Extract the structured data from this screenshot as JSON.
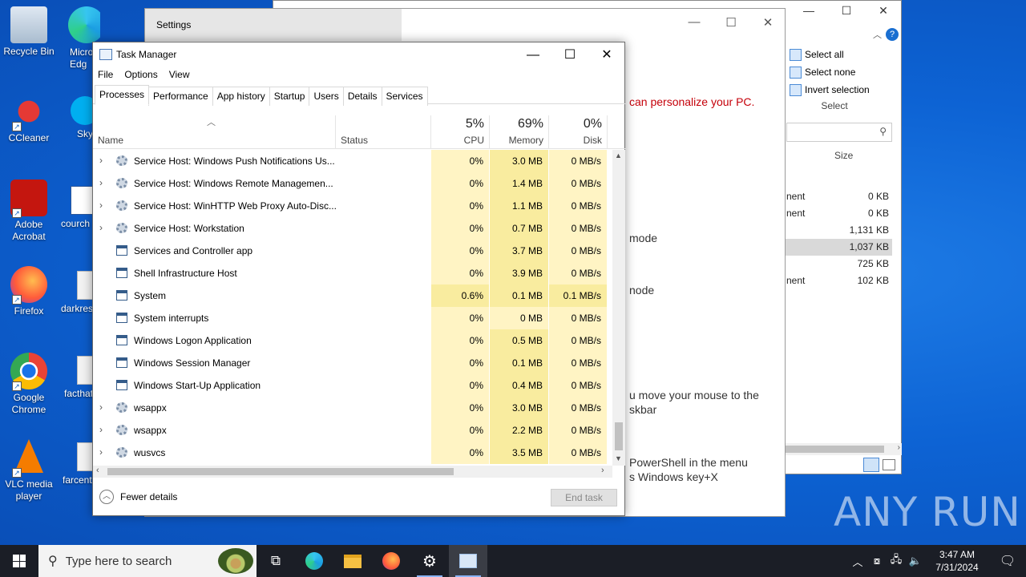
{
  "desktop": {
    "icons": [
      {
        "label": "Recycle Bin",
        "icon": "recycle-bin-icon"
      },
      {
        "label": "CCleaner",
        "icon": "ccleaner-icon"
      },
      {
        "label": "Adobe Acrobat",
        "icon": "acrobat-icon"
      },
      {
        "label": "Firefox",
        "icon": "firefox-icon"
      },
      {
        "label": "Google Chrome",
        "icon": "chrome-icon"
      },
      {
        "label": "VLC media player",
        "icon": "vlc-icon"
      }
    ],
    "partial_icons": [
      {
        "label": "Micro Edg",
        "icon": "edge-icon"
      },
      {
        "label": "Sky",
        "icon": "skype-icon"
      },
      {
        "label": "courch",
        "icon": "word-icon"
      },
      {
        "label": "darkres",
        "icon": "image-file-icon"
      },
      {
        "label": "facthat",
        "icon": "image-file-icon"
      },
      {
        "label": "farcent",
        "icon": "image-file-icon"
      }
    ]
  },
  "explorer": {
    "select_all": "Select all",
    "select_none": "Select none",
    "invert_selection": "Invert selection",
    "group_label": "Select",
    "size_header": "Size",
    "rows": [
      {
        "type": "nent",
        "size": "0 KB"
      },
      {
        "type": "nent",
        "size": "0 KB"
      },
      {
        "type": "",
        "size": "1,131 KB"
      },
      {
        "type": "",
        "size": "1,037 KB"
      },
      {
        "type": "",
        "size": "725 KB"
      },
      {
        "type": "nent",
        "size": "102 KB"
      }
    ]
  },
  "settings": {
    "title": "Settings",
    "lines": [
      "can personalize your PC.",
      "mode",
      "node",
      "u move your mouse to the",
      "skbar",
      "PowerShell in the menu",
      "s Windows key+X"
    ]
  },
  "taskmgr": {
    "title": "Task Manager",
    "menu": [
      "File",
      "Options",
      "View"
    ],
    "tabs": [
      "Processes",
      "Performance",
      "App history",
      "Startup",
      "Users",
      "Details",
      "Services"
    ],
    "active_tab": "Processes",
    "columns": {
      "name": "Name",
      "status": "Status",
      "cpu_pct": "5%",
      "cpu": "CPU",
      "mem_pct": "69%",
      "mem": "Memory",
      "disk_pct": "0%",
      "disk": "Disk"
    },
    "processes": [
      {
        "name": "Service Host: Windows Push Notifications Us...",
        "icon": "gear",
        "expandable": true,
        "cpu": "0%",
        "mem": "3.0 MB",
        "disk": "0 MB/s"
      },
      {
        "name": "Service Host: Windows Remote Managemen...",
        "icon": "gear",
        "expandable": true,
        "cpu": "0%",
        "mem": "1.4 MB",
        "disk": "0 MB/s"
      },
      {
        "name": "Service Host: WinHTTP Web Proxy Auto-Disc...",
        "icon": "gear",
        "expandable": true,
        "cpu": "0%",
        "mem": "1.1 MB",
        "disk": "0 MB/s"
      },
      {
        "name": "Service Host: Workstation",
        "icon": "gear",
        "expandable": true,
        "cpu": "0%",
        "mem": "0.7 MB",
        "disk": "0 MB/s"
      },
      {
        "name": "Services and Controller app",
        "icon": "win",
        "expandable": false,
        "cpu": "0%",
        "mem": "3.7 MB",
        "disk": "0 MB/s"
      },
      {
        "name": "Shell Infrastructure Host",
        "icon": "win",
        "expandable": false,
        "cpu": "0%",
        "mem": "3.9 MB",
        "disk": "0 MB/s"
      },
      {
        "name": "System",
        "icon": "win",
        "expandable": false,
        "cpu": "0.6%",
        "mem": "0.1 MB",
        "disk": "0.1 MB/s"
      },
      {
        "name": "System interrupts",
        "icon": "win",
        "expandable": false,
        "cpu": "0%",
        "mem": "0 MB",
        "disk": "0 MB/s"
      },
      {
        "name": "Windows Logon Application",
        "icon": "win",
        "expandable": false,
        "cpu": "0%",
        "mem": "0.5 MB",
        "disk": "0 MB/s"
      },
      {
        "name": "Windows Session Manager",
        "icon": "win",
        "expandable": false,
        "cpu": "0%",
        "mem": "0.1 MB",
        "disk": "0 MB/s"
      },
      {
        "name": "Windows Start-Up Application",
        "icon": "win",
        "expandable": false,
        "cpu": "0%",
        "mem": "0.4 MB",
        "disk": "0 MB/s"
      },
      {
        "name": "wsappx",
        "icon": "gear",
        "expandable": true,
        "cpu": "0%",
        "mem": "3.0 MB",
        "disk": "0 MB/s"
      },
      {
        "name": "wsappx",
        "icon": "gear",
        "expandable": true,
        "cpu": "0%",
        "mem": "2.2 MB",
        "disk": "0 MB/s"
      },
      {
        "name": "wusvcs",
        "icon": "gear",
        "expandable": true,
        "cpu": "0%",
        "mem": "3.5 MB",
        "disk": "0 MB/s"
      }
    ],
    "fewer_details": "Fewer details",
    "end_task": "End task"
  },
  "taskbar": {
    "search_placeholder": "Type here to search",
    "clock_time": "3:47 AM",
    "clock_date": "7/31/2024"
  },
  "watermark": "ANY RUN",
  "colors": {
    "heat_light": "#fff4c4",
    "heat_mid": "#f9ec9f",
    "taskbar": "#1b1e26",
    "desktop": "#0d63d4"
  }
}
